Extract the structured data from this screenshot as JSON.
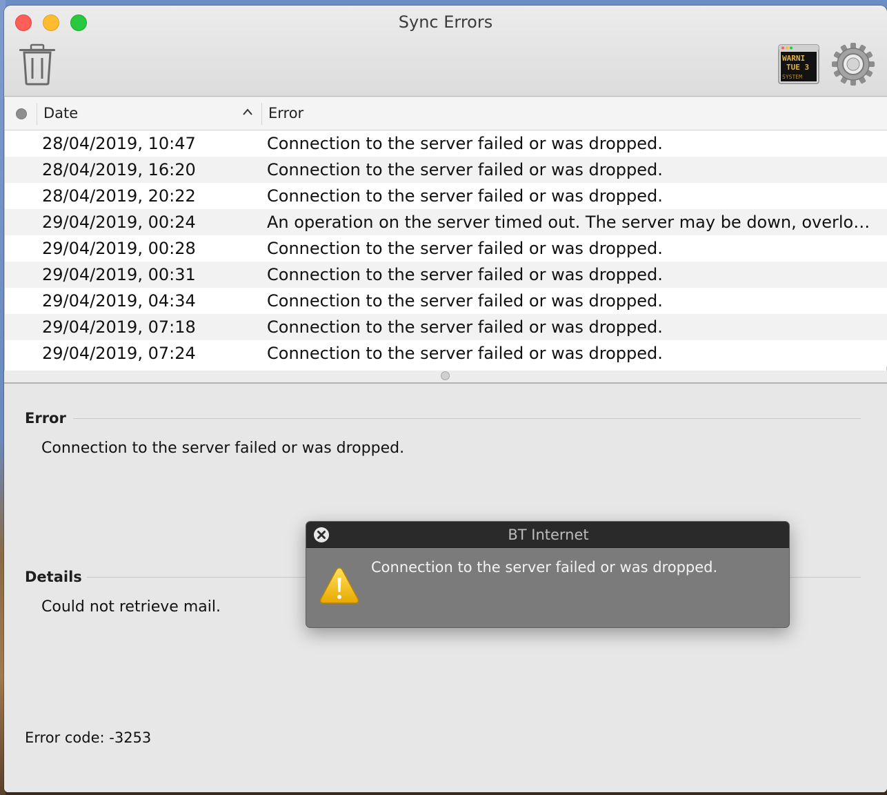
{
  "window": {
    "title": "Sync Errors"
  },
  "toolbar": {
    "trash_icon": "trash-icon",
    "console_icon": "console-warning-icon",
    "console_screen_lines": [
      "WARNI",
      "TUE 3",
      "SYSTEM"
    ],
    "settings_icon": "gear-icon"
  },
  "table": {
    "columns": {
      "status": "",
      "date": "Date",
      "error": "Error"
    },
    "sort": "ascending",
    "rows": [
      {
        "date": "28/04/2019, 10:47",
        "error": "Connection to the server failed or was dropped."
      },
      {
        "date": "28/04/2019, 16:20",
        "error": "Connection to the server failed or was dropped."
      },
      {
        "date": "28/04/2019, 20:22",
        "error": "Connection to the server failed or was dropped."
      },
      {
        "date": "29/04/2019, 00:24",
        "error": "An operation on the server timed out. The server may be down, overloa…"
      },
      {
        "date": "29/04/2019, 00:28",
        "error": "Connection to the server failed or was dropped."
      },
      {
        "date": "29/04/2019, 00:31",
        "error": "Connection to the server failed or was dropped."
      },
      {
        "date": "29/04/2019, 04:34",
        "error": "Connection to the server failed or was dropped."
      },
      {
        "date": "29/04/2019, 07:18",
        "error": "Connection to the server failed or was dropped."
      },
      {
        "date": "29/04/2019, 07:24",
        "error": "Connection to the server failed or was dropped."
      }
    ]
  },
  "detail": {
    "error_heading": "Error",
    "error_text": "Connection to the server failed or was dropped.",
    "details_heading": "Details",
    "details_text": "Could not retrieve mail.",
    "error_code": "Error code: -3253"
  },
  "notification": {
    "title": "BT Internet",
    "message": "Connection to the server failed or was dropped.",
    "icon": "warning-icon",
    "close_icon": "close-icon"
  },
  "colors": {
    "close": "#fe5f57",
    "minimize": "#febc2e",
    "maximize": "#28c840",
    "hud_background": "#7b7b7b",
    "hud_titlebar": "#2a2a2a",
    "warning": "#f5c400"
  }
}
